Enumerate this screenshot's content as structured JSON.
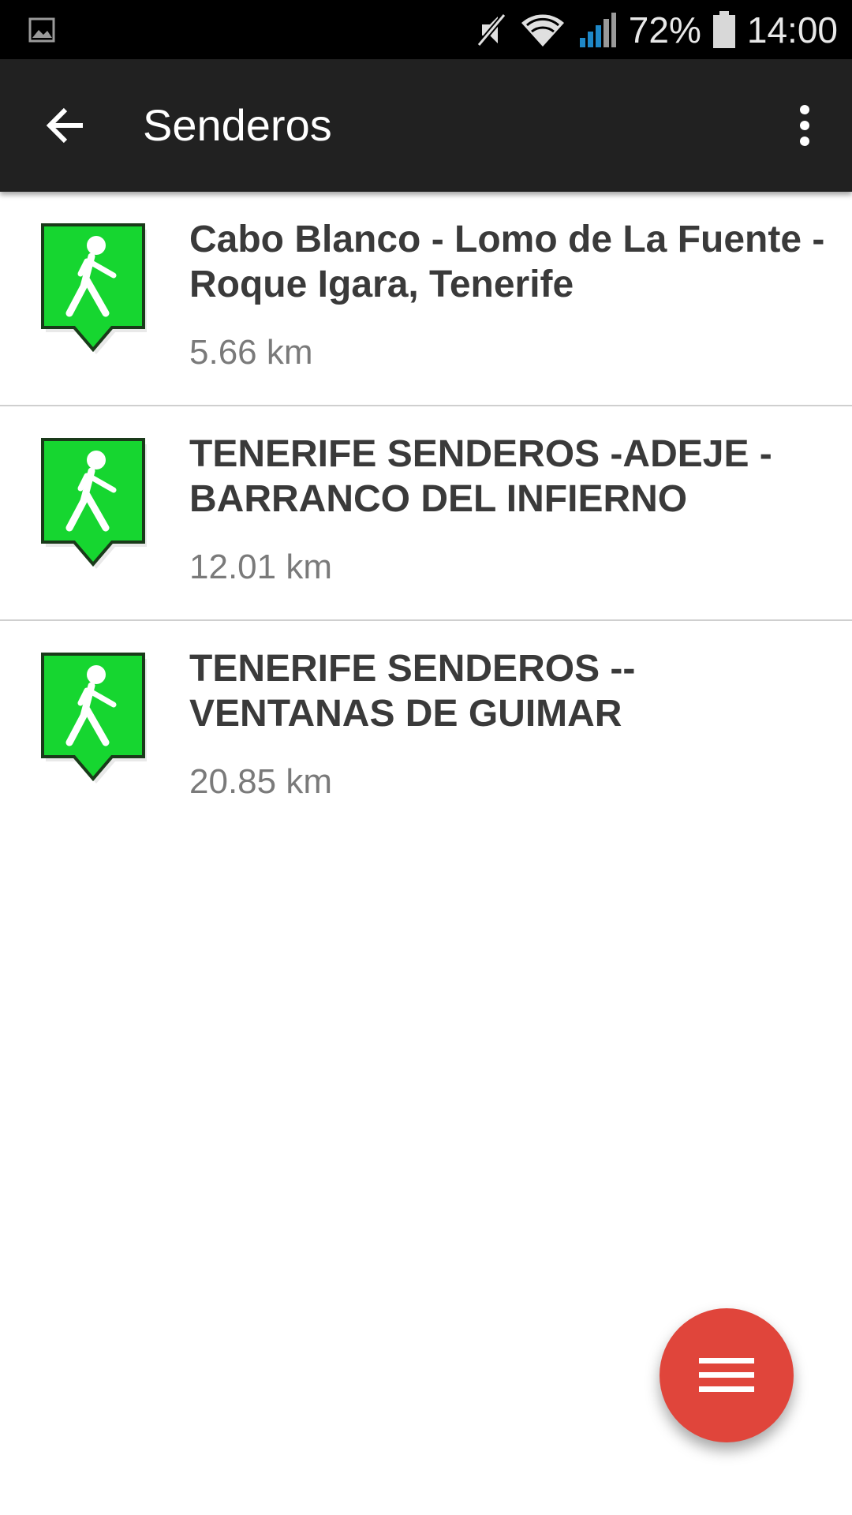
{
  "status_bar": {
    "battery_percent": "72%",
    "time": "14:00",
    "icons": [
      "image-notification-icon",
      "mute-icon",
      "wifi-icon",
      "signal-icon",
      "battery-icon"
    ]
  },
  "app_bar": {
    "title": "Senderos",
    "back_icon": "arrow-back-icon",
    "menu_icon": "more-vert-icon"
  },
  "trails": [
    {
      "name": "Cabo Blanco - Lomo de La Fuente - Roque Igara, Tenerife",
      "distance": "5.66 km",
      "icon": "hiking-marker-icon"
    },
    {
      "name": "TENERIFE SENDEROS -ADEJE - BARRANCO DEL INFIERNO",
      "distance": "12.01 km",
      "icon": "hiking-marker-icon"
    },
    {
      "name": "TENERIFE SENDEROS -- VENTANAS DE GUIMAR",
      "distance": "20.85 km",
      "icon": "hiking-marker-icon"
    }
  ],
  "fab": {
    "icon": "menu-icon"
  },
  "colors": {
    "status_bar_bg": "#000000",
    "app_bar_bg": "#212121",
    "marker_green": "#16d630",
    "fab_red": "#e0453b",
    "title_text": "#3a3a3a",
    "distance_text": "#7a7a7a"
  }
}
